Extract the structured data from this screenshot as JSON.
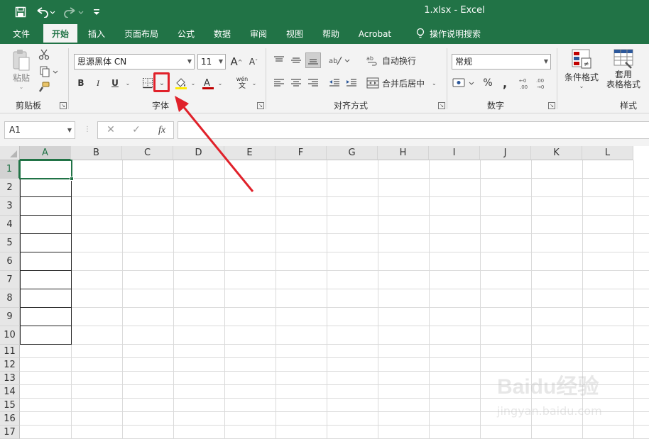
{
  "titlebar": {
    "file_title": "1.xlsx  -  Excel",
    "save_icon": "save-icon",
    "undo_icon": "undo-icon",
    "redo_icon": "redo-icon",
    "customize_icon": "customize-quick-access-icon"
  },
  "tabs": [
    {
      "label": "文件"
    },
    {
      "label": "开始"
    },
    {
      "label": "插入"
    },
    {
      "label": "页面布局"
    },
    {
      "label": "公式"
    },
    {
      "label": "数据"
    },
    {
      "label": "审阅"
    },
    {
      "label": "视图"
    },
    {
      "label": "帮助"
    },
    {
      "label": "Acrobat"
    },
    {
      "label": "操作说明搜索"
    }
  ],
  "ribbon": {
    "clipboard": {
      "paste_label": "粘贴",
      "group_label": "剪贴板"
    },
    "font": {
      "font_name": "思源黑体 CN",
      "font_size": "11",
      "bold": "B",
      "italic": "I",
      "underline": "U",
      "phonetic_top": "wén",
      "phonetic_bottom": "文",
      "group_label": "字体"
    },
    "alignment": {
      "wrap_text": "自动换行",
      "merge_center": "合并后居中",
      "group_label": "对齐方式"
    },
    "number": {
      "format": "常规",
      "percent": "%",
      "comma": ",",
      "group_label": "数字"
    },
    "styles": {
      "conditional_format": "条件格式",
      "table_format_1": "套用",
      "table_format_2": "表格格式",
      "group_label": "样式"
    }
  },
  "formula_bar": {
    "name_box": "A1",
    "cancel": "✕",
    "enter": "✓",
    "fx": "fx",
    "formula": ""
  },
  "grid": {
    "columns": [
      "A",
      "B",
      "C",
      "D",
      "E",
      "F",
      "G",
      "H",
      "I",
      "J",
      "K",
      "L"
    ],
    "rows": [
      "1",
      "2",
      "3",
      "4",
      "5",
      "6",
      "7",
      "8",
      "9",
      "10",
      "11",
      "12",
      "13",
      "14",
      "15",
      "16",
      "17"
    ],
    "selected_cell": "A1"
  },
  "watermark": {
    "text": "Baidu经验",
    "url": "jingyan.baidu.com"
  },
  "colors": {
    "excel_green": "#217346",
    "highlight_red": "#e0212a"
  }
}
